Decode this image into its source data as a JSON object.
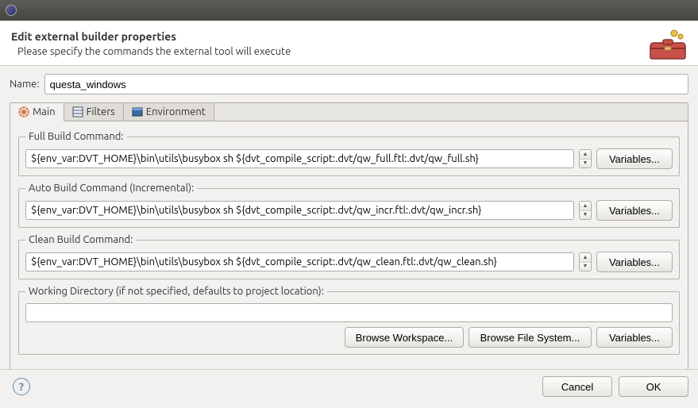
{
  "window": {
    "title": ""
  },
  "header": {
    "title": "Edit external builder properties",
    "subtitle": "Please specify the commands the external tool will execute"
  },
  "name": {
    "label": "Name:",
    "value": "questa_windows"
  },
  "tabs": {
    "main": "Main",
    "filters": "Filters",
    "environment": "Environment"
  },
  "main_panel": {
    "full_build": {
      "legend": "Full Build Command:",
      "value": "${env_var:DVT_HOME}\\bin\\utils\\busybox sh ${dvt_compile_script:.dvt/qw_full.ftl:.dvt/qw_full.sh}",
      "variables_btn": "Variables..."
    },
    "auto_build": {
      "legend": "Auto Build Command (Incremental):",
      "value": "${env_var:DVT_HOME}\\bin\\utils\\busybox sh ${dvt_compile_script:.dvt/qw_incr.ftl:.dvt/qw_incr.sh}",
      "variables_btn": "Variables..."
    },
    "clean_build": {
      "legend": "Clean Build Command:",
      "value": "${env_var:DVT_HOME}\\bin\\utils\\busybox sh ${dvt_compile_script:.dvt/qw_clean.ftl:.dvt/qw_clean.sh}",
      "variables_btn": "Variables..."
    },
    "working_dir": {
      "legend": "Working Directory (if not specified, defaults to project location):",
      "value": "",
      "browse_workspace": "Browse Workspace...",
      "browse_filesystem": "Browse File System...",
      "variables_btn": "Variables..."
    }
  },
  "footer": {
    "cancel": "Cancel",
    "ok": "OK"
  }
}
